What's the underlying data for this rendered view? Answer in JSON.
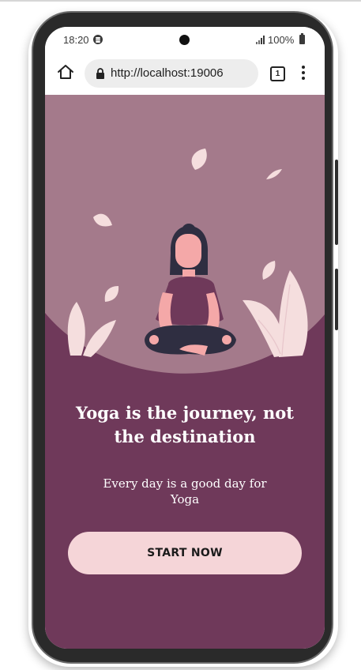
{
  "status_bar": {
    "time": "18:20",
    "battery": "100%",
    "icons": [
      "spotify-icon",
      "camera-icon",
      "signal-icon",
      "battery-icon"
    ]
  },
  "browser": {
    "url": "http://localhost:19006",
    "tab_count": "1",
    "icons": [
      "home-icon",
      "lock-icon",
      "tab-switcher-icon",
      "more-vert-icon"
    ]
  },
  "hero": {
    "illustration": "meditating-woman-with-leaves",
    "icons": [
      "leaf-icon",
      "plant-icon"
    ]
  },
  "main": {
    "headline": "Yoga is the journey, not the destination",
    "subtitle": "Every day is a good day for Yoga",
    "cta_label": "START NOW"
  },
  "colors": {
    "page_background": "#6f395a",
    "hero_background": "#a47a8b",
    "button_background": "#f5d5d8",
    "plant": "#f5dede",
    "figure_shirt": "#6f395a",
    "figure_skin": "#f4a8a8",
    "figure_hair": "#2f2e41",
    "text_primary": "#ffffff",
    "button_text": "#1b1b1b"
  }
}
